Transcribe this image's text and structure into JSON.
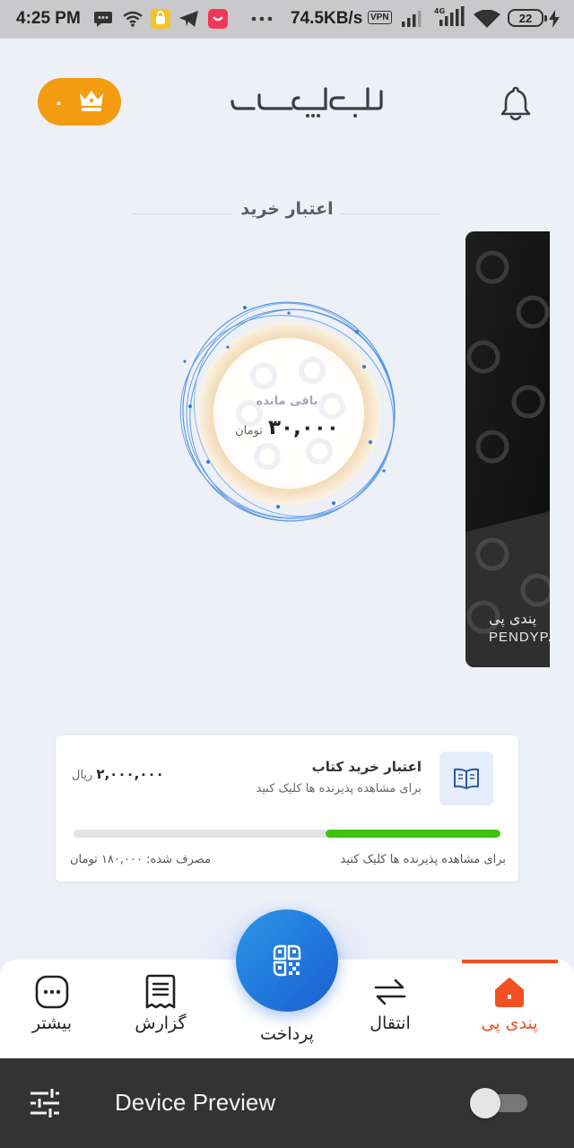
{
  "status_bar": {
    "time": "4:25 PM",
    "net_speed": "74.5KB/s",
    "vpn": "VPN",
    "battery": "22",
    "network_type": "4G",
    "icons": [
      "message-icon",
      "wifi-icon",
      "app-yellow-icon",
      "telegram-icon",
      "app-red-icon",
      "more-dots-icon",
      "signal-icon",
      "wifi-icon",
      "charging-icon"
    ]
  },
  "header": {
    "premium_count": "۰",
    "logo_text": "پندی پی"
  },
  "section": {
    "title": "اعتبار خرید"
  },
  "balance": {
    "label": "باقی مانده",
    "amount": "۳۰,۰۰۰",
    "currency": "تومان"
  },
  "side_card": {
    "brand_fa": "پندی پی",
    "brand_en": "PENDYPA"
  },
  "book_credit": {
    "title": "اعتبار خرید کتاب",
    "subtitle": "برای مشاهده پذیرنده ها کلیک کنید",
    "amount": "۲,۰۰۰,۰۰۰",
    "currency": "ریال",
    "progress": 0.41,
    "footer_right": "برای مشاهده پذیرنده ها کلیک کنید",
    "footer_left": "مصرف شده: ۱۸۰,۰۰۰ تومان"
  },
  "bottom_nav": {
    "items": [
      {
        "label": "پندی پی",
        "icon": "home-icon",
        "active": true
      },
      {
        "label": "انتقال",
        "icon": "transfer-arrows-icon",
        "active": false
      },
      {
        "label": "پرداخت",
        "icon": "qr-payment-icon",
        "active": false
      },
      {
        "label": "گزارش",
        "icon": "receipt-icon",
        "active": false
      },
      {
        "label": "بیشتر",
        "icon": "more-icon",
        "active": false
      }
    ]
  },
  "device_preview": {
    "label": "Device Preview",
    "toggle_on": false
  },
  "colors": {
    "accent_orange": "#f39c12",
    "active_nav": "#f25022",
    "fab_blue": "#1b5fd1",
    "progress_green": "#3ec20e"
  }
}
